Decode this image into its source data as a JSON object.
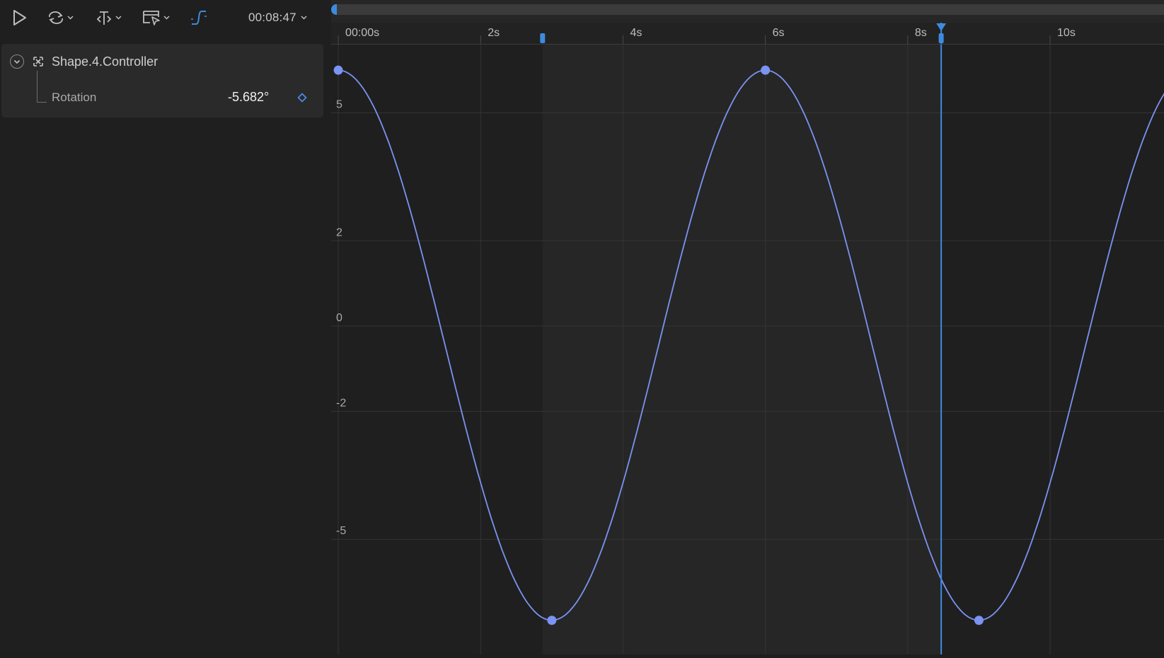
{
  "toolbar": {
    "play_icon": "play-icon",
    "loop_icon": "loop-icon",
    "snap_icon": "snap-icon",
    "preview_icon": "preview-icon",
    "curve_icon": "curve-editor-icon",
    "timecode": "00:08:47",
    "accent": "#3d8be0"
  },
  "layer": {
    "name": "Shape.4.Controller",
    "property": {
      "name": "Rotation",
      "value": "-5.682°"
    }
  },
  "graph": {
    "curve_color": "#7b93f2",
    "accent": "#3d8be0",
    "playhead_time": 8.47,
    "range_marker_time": 2.87,
    "work_area_start": 2.87,
    "work_area_end": 8.47
  },
  "chart_data": {
    "type": "line",
    "xlabel": "",
    "ylabel": "",
    "x_tick_labels": [
      "00:00s",
      "2s",
      "4s",
      "6s",
      "8s",
      "10s"
    ],
    "x_tick_values": [
      0,
      2,
      4,
      6,
      8,
      10
    ],
    "y_tick_labels": [
      "5",
      "2",
      "0",
      "-2",
      "-5"
    ],
    "y_tick_values": [
      5,
      2,
      0,
      -2,
      -5
    ],
    "xlim": [
      -0.1,
      11.6
    ],
    "ylim": [
      -7.7,
      6.6
    ],
    "keyframes": [
      {
        "t": 0.0,
        "v": 6.0
      },
      {
        "t": 3.0,
        "v": -6.9
      },
      {
        "t": 6.0,
        "v": 6.0
      },
      {
        "t": 9.0,
        "v": -6.9
      },
      {
        "t": 12.0,
        "v": 6.0
      }
    ]
  }
}
